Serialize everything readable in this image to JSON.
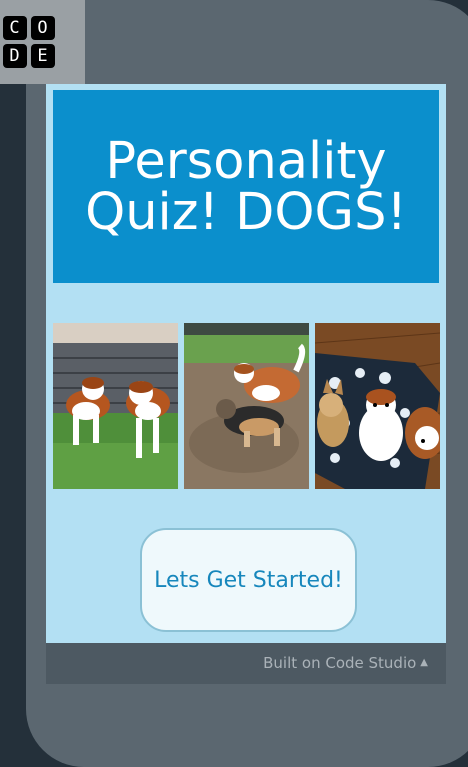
{
  "logo": {
    "letters": [
      "C",
      "O",
      "D",
      "D",
      "E",
      ""
    ]
  },
  "app": {
    "title": "Personality Quiz! DOGS!",
    "photos": [
      {
        "name": "dogs-on-turf-photo",
        "alt": ""
      },
      {
        "name": "dogs-playing-photo",
        "alt": ""
      },
      {
        "name": "dogs-in-house-photo",
        "alt": ""
      }
    ],
    "start_button": "Lets Get Started!"
  },
  "footer": {
    "built_on": "Built on Code Studio",
    "caret_icon": "caret-up-icon"
  },
  "colors": {
    "screen_bg": "#b3e0f3",
    "title_bg": "#0b8fcc",
    "button_text": "#1787bc",
    "frame": "#5b6770"
  }
}
